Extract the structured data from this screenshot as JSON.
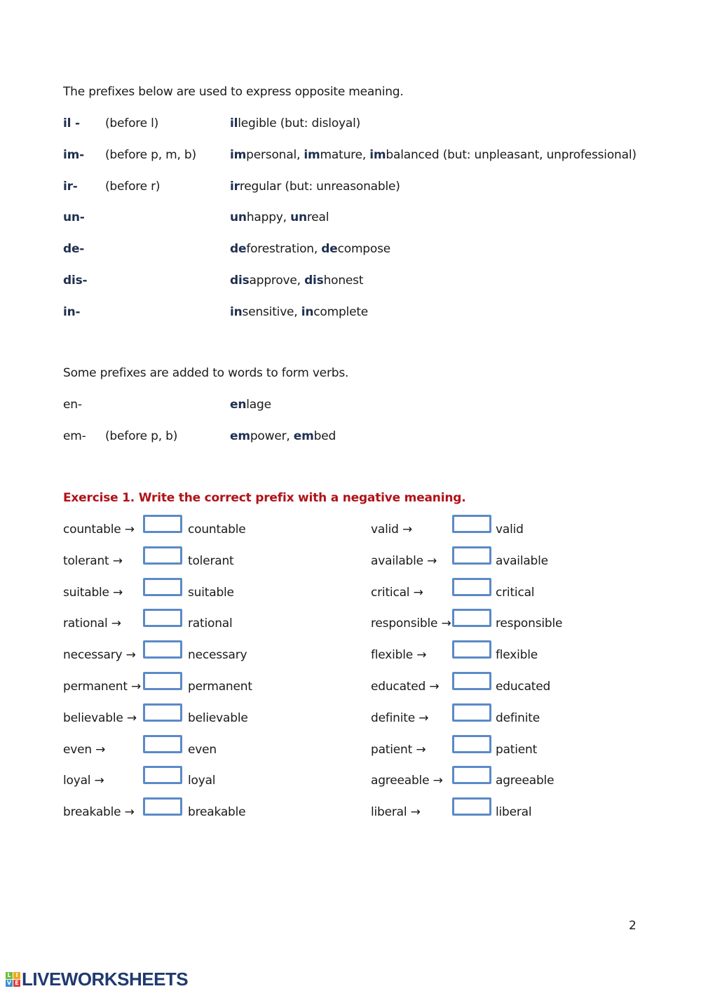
{
  "reference": {
    "intro": "The prefixes below are used to express opposite meaning.",
    "rows": [
      {
        "prefix": "il -",
        "note": "(before l)",
        "examples": [
          {
            "bold": "il",
            "rest": "legible (but: disloyal)"
          }
        ]
      },
      {
        "prefix": "im-",
        "note": "(before p, m, b)",
        "examples": [
          {
            "bold": "im",
            "rest": "personal, "
          },
          {
            "bold": "im",
            "rest": "mature, "
          },
          {
            "bold": "im",
            "rest": "balanced (but: unpleasant, unprofessional)"
          }
        ]
      },
      {
        "prefix": "ir-",
        "note": "(before r)",
        "examples": [
          {
            "bold": "ir",
            "rest": "regular (but: unreasonable)"
          }
        ]
      },
      {
        "prefix": "un-",
        "note": "",
        "examples": [
          {
            "bold": "un",
            "rest": "happy, "
          },
          {
            "bold": "un",
            "rest": "real"
          }
        ]
      },
      {
        "prefix": "de-",
        "note": "",
        "examples": [
          {
            "bold": "de",
            "rest": "forestration, "
          },
          {
            "bold": "de",
            "rest": "compose"
          }
        ]
      },
      {
        "prefix": "dis-",
        "note": "",
        "examples": [
          {
            "bold": "dis",
            "rest": "approve, "
          },
          {
            "bold": "dis",
            "rest": "honest"
          }
        ]
      },
      {
        "prefix": "in-",
        "note": "",
        "examples": [
          {
            "bold": "in",
            "rest": "sensitive, "
          },
          {
            "bold": "in",
            "rest": "complete"
          }
        ]
      }
    ]
  },
  "verbs": {
    "intro": "Some prefixes are added to words to form verbs.",
    "rows": [
      {
        "prefix": "en-",
        "note": "",
        "examples": [
          {
            "bold": "en",
            "rest": "lage"
          }
        ]
      },
      {
        "prefix": "em-",
        "note": "(before p, b)",
        "examples": [
          {
            "bold": "em",
            "rest": "power, "
          },
          {
            "bold": "em",
            "rest": "bed"
          }
        ]
      }
    ]
  },
  "exercise": {
    "title": "Exercise 1.  Write the correct prefix with a negative meaning.",
    "arrow": "→",
    "left": [
      {
        "word": "countable",
        "answer": ""
      },
      {
        "word": "tolerant",
        "answer": ""
      },
      {
        "word": "suitable",
        "answer": ""
      },
      {
        "word": "rational",
        "answer": ""
      },
      {
        "word": "necessary",
        "answer": ""
      },
      {
        "word": "permanent",
        "answer": ""
      },
      {
        "word": "believable",
        "answer": ""
      },
      {
        "word": "even",
        "answer": ""
      },
      {
        "word": "loyal",
        "answer": ""
      },
      {
        "word": "breakable",
        "answer": ""
      }
    ],
    "right": [
      {
        "word": "valid",
        "answer": ""
      },
      {
        "word": "available",
        "answer": ""
      },
      {
        "word": "critical",
        "answer": ""
      },
      {
        "word": "responsible",
        "answer": ""
      },
      {
        "word": "flexible",
        "answer": ""
      },
      {
        "word": "educated",
        "answer": ""
      },
      {
        "word": "definite",
        "answer": ""
      },
      {
        "word": "patient",
        "answer": ""
      },
      {
        "word": "agreeable",
        "answer": ""
      },
      {
        "word": "liberal",
        "answer": ""
      }
    ]
  },
  "page_number": "2",
  "footer": {
    "logo_text": "LIVEWORKSHEETS",
    "logo_icon_letters": [
      "L",
      "I",
      "V",
      "E"
    ],
    "logo_icon_colors": [
      "#6fbf3b",
      "#f2a71b",
      "#3a8fd8",
      "#e0413a"
    ]
  }
}
